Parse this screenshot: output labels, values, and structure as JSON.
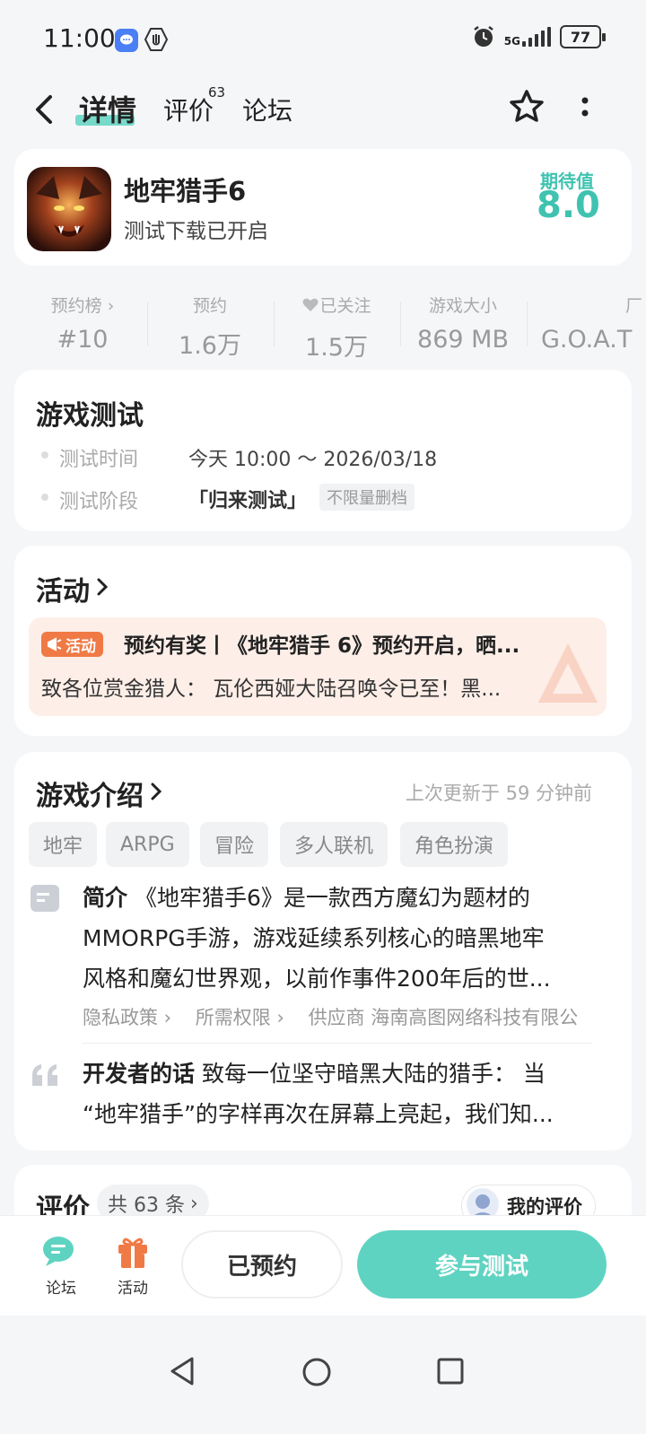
{
  "status_bar": {
    "time": "11:00",
    "network": "5G",
    "battery": "77"
  },
  "nav": {
    "tabs": [
      {
        "label": "详情",
        "active": true
      },
      {
        "label": "评价",
        "badge": "63"
      },
      {
        "label": "论坛"
      }
    ]
  },
  "game": {
    "name": "地牢猎手6",
    "subtitle": "测试下载已开启",
    "score_label": "期待值",
    "score": "8.0"
  },
  "stats": [
    {
      "label": "预约榜",
      "value": "#10"
    },
    {
      "label": "预约",
      "value": "1.6万"
    },
    {
      "label": "已关注",
      "value": "1.5万"
    },
    {
      "label": "游戏大小",
      "value": "869 MB"
    },
    {
      "label": "厂",
      "value": "G.O.A.T"
    }
  ],
  "test": {
    "title": "游戏测试",
    "time_label": "测试时间",
    "time_value": "今天 10:00 ～ 2026/03/18",
    "phase_label": "测试阶段",
    "phase_value": "「归来测试」",
    "phase_tag": "不限量删档"
  },
  "activity": {
    "title": "活动",
    "badge": "活动",
    "headline": "预约有奖丨《地牢猎手 6》预约开启，晒...",
    "body": "致各位赏金猎人： 瓦伦西娅大陆召唤令已至！黑..."
  },
  "intro": {
    "title": "游戏介绍",
    "updated": "上次更新于 59 分钟前",
    "tags": [
      "地牢",
      "ARPG",
      "冒险",
      "多人联机",
      "角色扮演"
    ],
    "summary_label": "简介",
    "summary_line1": "《地牢猎手6》是一款西方魔幻为题材的",
    "summary_line2": "MMORPG手游，游戏延续系列核心的暗黑地牢",
    "summary_line3": "风格和魔幻世界观，以前作事件200年后的世...",
    "links": {
      "privacy": "隐私政策",
      "permissions": "所需权限",
      "supplier": "供应商 海南高图网络科技有限公"
    },
    "dev_label": "开发者的话",
    "dev_line1": "致每一位坚守暗黑大陆的猎手： 当",
    "dev_line2": "“地牢猎手”的字样再次在屏幕上亮起，我们知..."
  },
  "reviews": {
    "title": "评价",
    "count": "共 63 条",
    "my_review": "我的评价"
  },
  "bottom": {
    "forum": "论坛",
    "activity": "活动",
    "reserved": "已预约",
    "join": "参与测试"
  },
  "colors": {
    "accent": "#5fd3c1",
    "activity_orange": "#f07a45",
    "activity_bg": "#fdeee8"
  }
}
